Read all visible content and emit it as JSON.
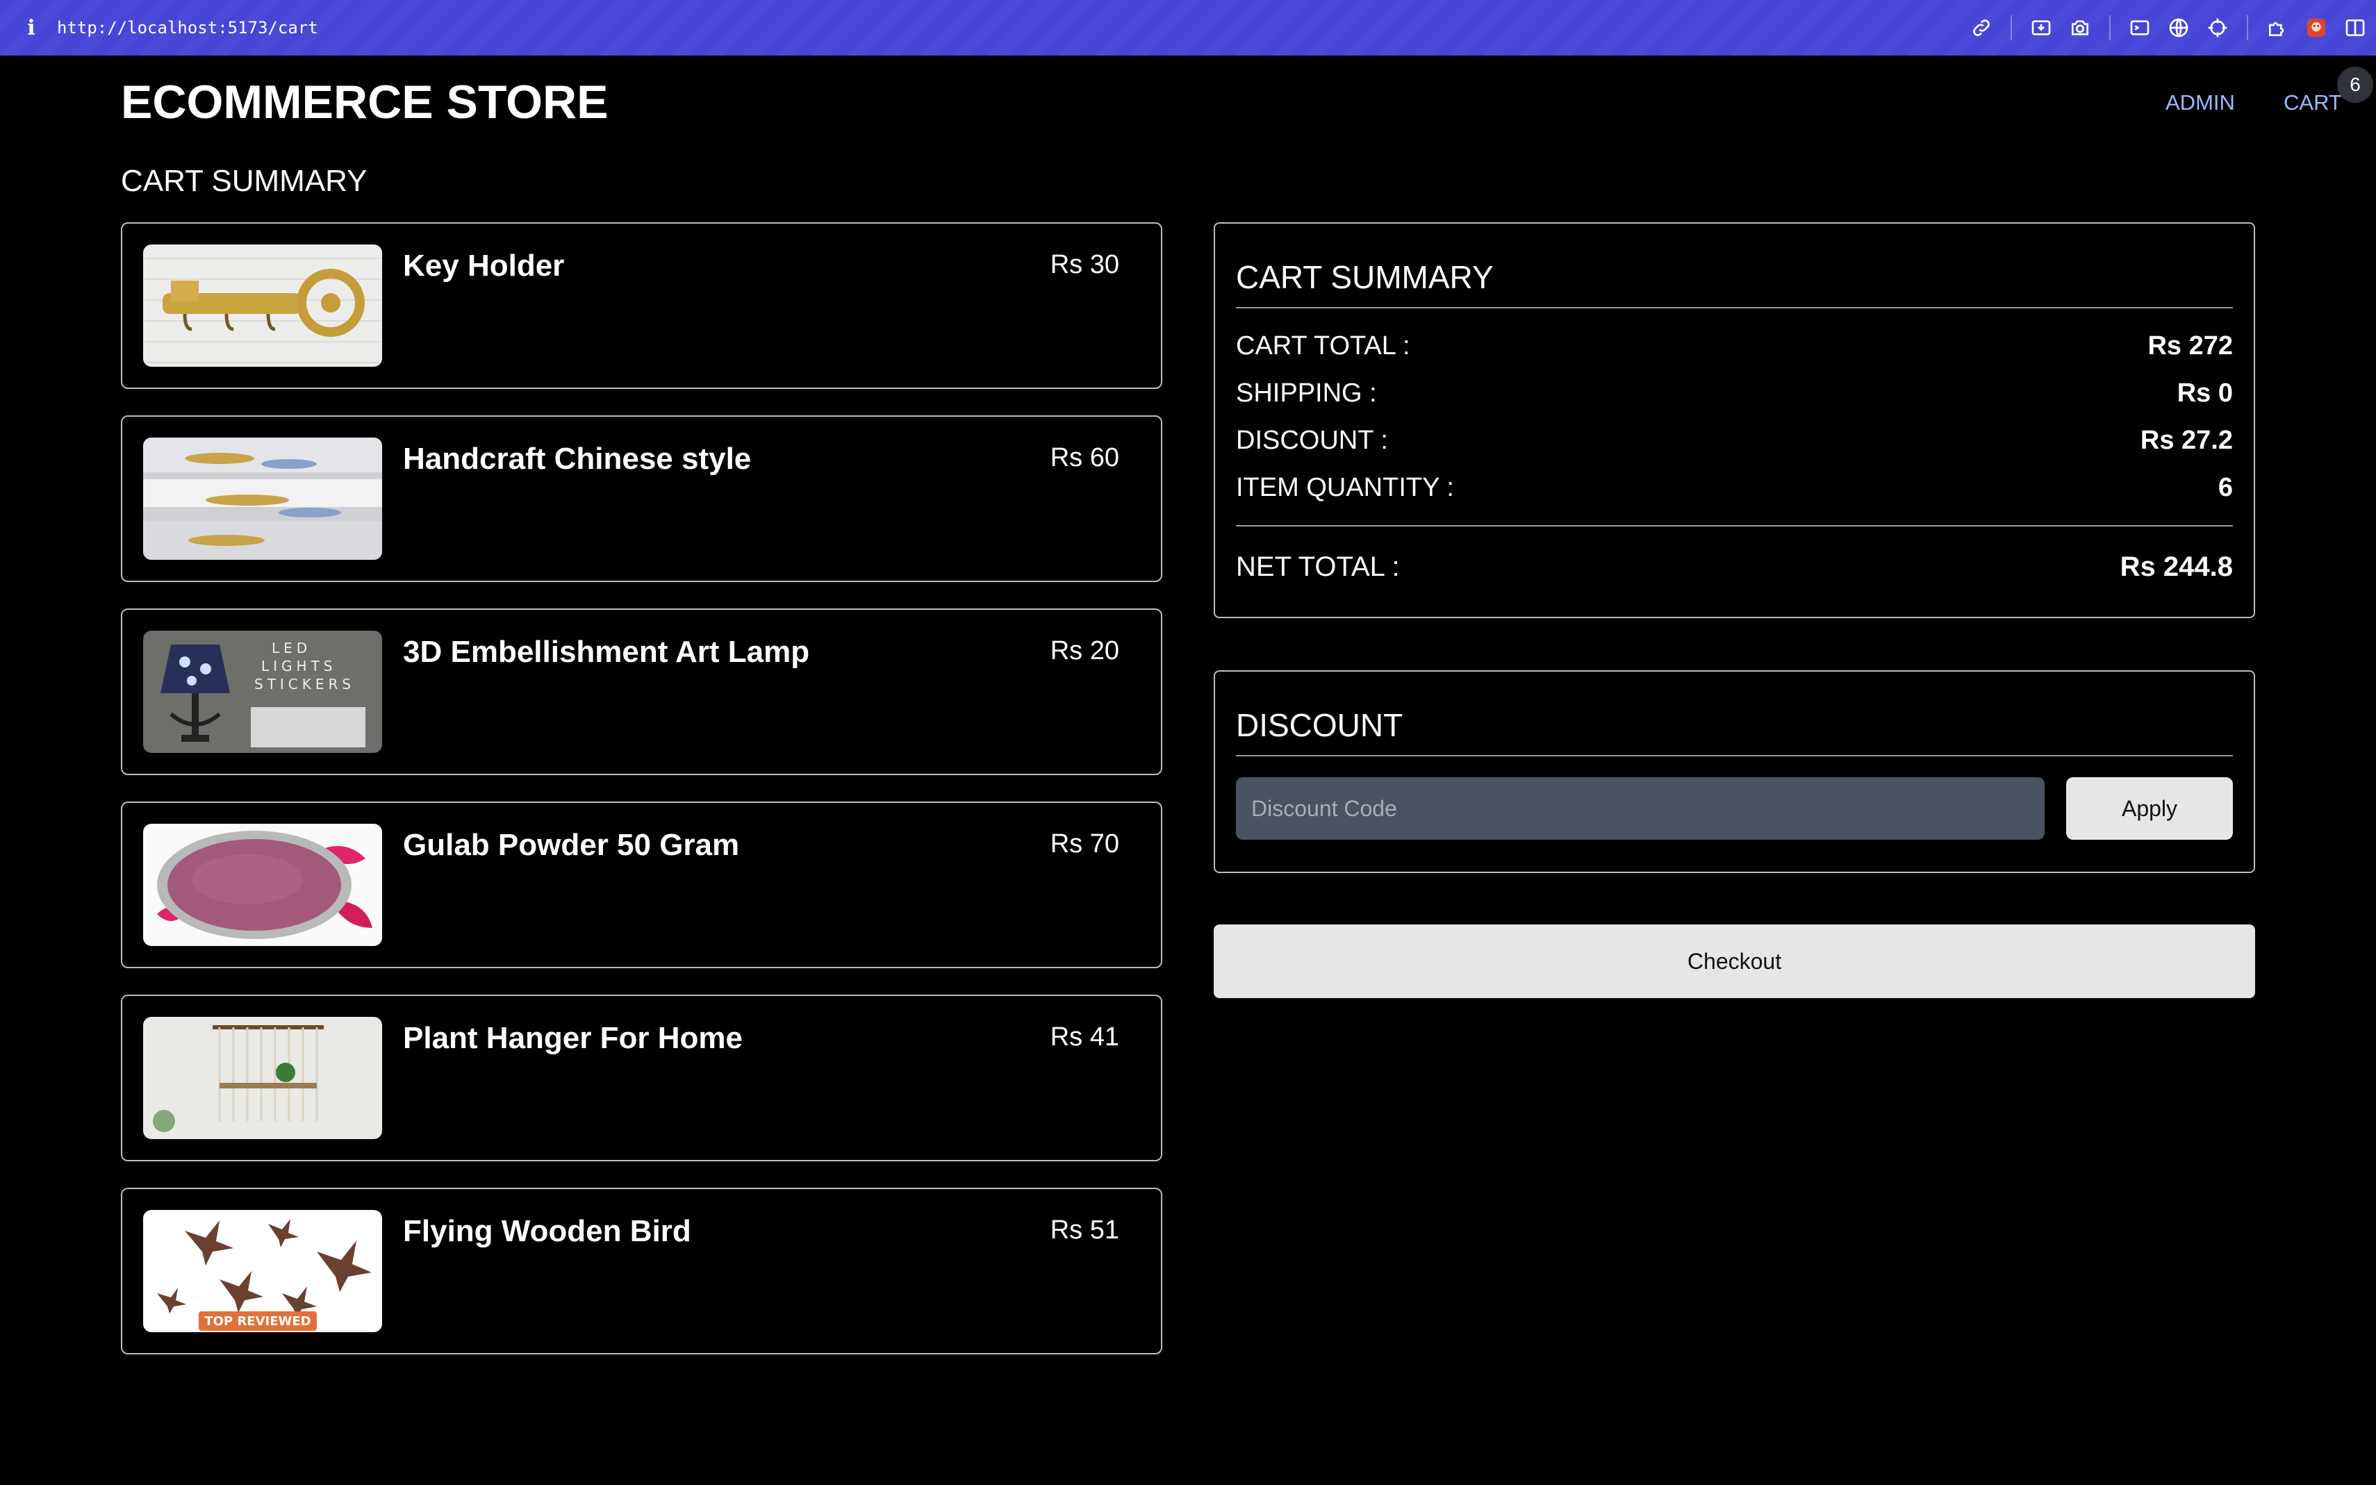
{
  "browser": {
    "url": "http://localhost:5173/cart",
    "icons": [
      "info-icon",
      "link-icon",
      "download-icon",
      "camera-icon",
      "terminal-icon",
      "globe-icon",
      "crosshair-icon",
      "extension-icon",
      "profile-icon",
      "sidebar-icon"
    ]
  },
  "header": {
    "title": "ECOMMERCE STORE",
    "nav": {
      "admin": "ADMIN",
      "cart": "CART"
    },
    "cart_count": "6"
  },
  "page": {
    "heading": "CART SUMMARY"
  },
  "products": [
    {
      "name": "Key Holder",
      "price": "Rs 30",
      "image": "key-holder-image"
    },
    {
      "name": "Handcraft Chinese style",
      "price": "Rs 60",
      "image": "handcraft-image"
    },
    {
      "name": "3D Embellishment Art Lamp",
      "price": "Rs 20",
      "image": "lamp-image",
      "image_text": [
        "LED",
        "LIGHTS",
        "STICKERS"
      ]
    },
    {
      "name": "Gulab Powder 50 Gram",
      "price": "Rs 70",
      "image": "gulab-powder-image"
    },
    {
      "name": "Plant Hanger For Home",
      "price": "Rs 41",
      "image": "plant-hanger-image"
    },
    {
      "name": "Flying Wooden Bird",
      "price": "Rs 51",
      "image": "wooden-bird-image",
      "image_badge": "TOP REVIEWED"
    }
  ],
  "summary": {
    "title": "CART SUMMARY",
    "rows": [
      {
        "label": "CART TOTAL :",
        "value": "Rs 272"
      },
      {
        "label": "SHIPPING :",
        "value": "Rs 0"
      },
      {
        "label": "DISCOUNT :",
        "value": "Rs 27.2"
      },
      {
        "label": "ITEM QUANTITY :",
        "value": "6"
      }
    ],
    "net_label": "NET TOTAL :",
    "net_value": "Rs 244.8"
  },
  "discount": {
    "title": "DISCOUNT",
    "placeholder": "Discount Code",
    "value": "",
    "apply_label": "Apply"
  },
  "checkout_label": "Checkout",
  "colors": {
    "browser_bar": "#4545d6",
    "nav_link": "#9db8ff",
    "input_bg": "#4b5260",
    "button_bg": "#e5e6e8"
  }
}
